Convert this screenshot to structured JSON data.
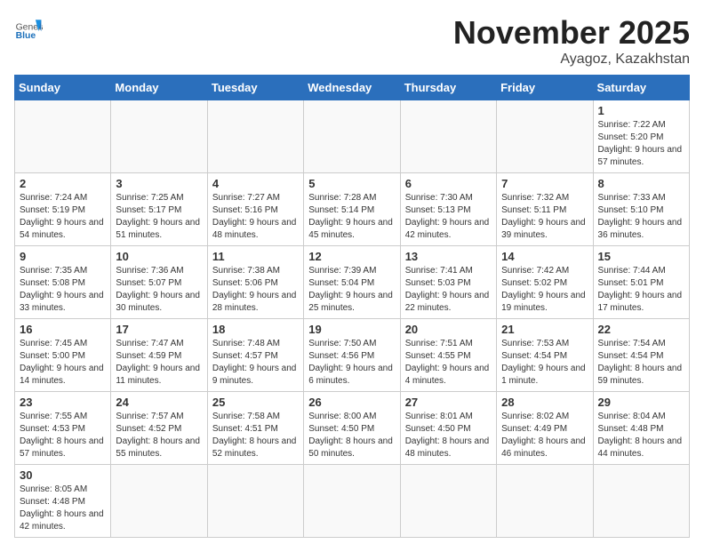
{
  "logo": {
    "general": "General",
    "blue": "Blue"
  },
  "title": "November 2025",
  "location": "Ayagoz, Kazakhstan",
  "weekdays": [
    "Sunday",
    "Monday",
    "Tuesday",
    "Wednesday",
    "Thursday",
    "Friday",
    "Saturday"
  ],
  "weeks": [
    [
      {
        "day": "",
        "info": ""
      },
      {
        "day": "",
        "info": ""
      },
      {
        "day": "",
        "info": ""
      },
      {
        "day": "",
        "info": ""
      },
      {
        "day": "",
        "info": ""
      },
      {
        "day": "",
        "info": ""
      },
      {
        "day": "1",
        "info": "Sunrise: 7:22 AM\nSunset: 5:20 PM\nDaylight: 9 hours\nand 57 minutes."
      }
    ],
    [
      {
        "day": "2",
        "info": "Sunrise: 7:24 AM\nSunset: 5:19 PM\nDaylight: 9 hours\nand 54 minutes."
      },
      {
        "day": "3",
        "info": "Sunrise: 7:25 AM\nSunset: 5:17 PM\nDaylight: 9 hours\nand 51 minutes."
      },
      {
        "day": "4",
        "info": "Sunrise: 7:27 AM\nSunset: 5:16 PM\nDaylight: 9 hours\nand 48 minutes."
      },
      {
        "day": "5",
        "info": "Sunrise: 7:28 AM\nSunset: 5:14 PM\nDaylight: 9 hours\nand 45 minutes."
      },
      {
        "day": "6",
        "info": "Sunrise: 7:30 AM\nSunset: 5:13 PM\nDaylight: 9 hours\nand 42 minutes."
      },
      {
        "day": "7",
        "info": "Sunrise: 7:32 AM\nSunset: 5:11 PM\nDaylight: 9 hours\nand 39 minutes."
      },
      {
        "day": "8",
        "info": "Sunrise: 7:33 AM\nSunset: 5:10 PM\nDaylight: 9 hours\nand 36 minutes."
      }
    ],
    [
      {
        "day": "9",
        "info": "Sunrise: 7:35 AM\nSunset: 5:08 PM\nDaylight: 9 hours\nand 33 minutes."
      },
      {
        "day": "10",
        "info": "Sunrise: 7:36 AM\nSunset: 5:07 PM\nDaylight: 9 hours\nand 30 minutes."
      },
      {
        "day": "11",
        "info": "Sunrise: 7:38 AM\nSunset: 5:06 PM\nDaylight: 9 hours\nand 28 minutes."
      },
      {
        "day": "12",
        "info": "Sunrise: 7:39 AM\nSunset: 5:04 PM\nDaylight: 9 hours\nand 25 minutes."
      },
      {
        "day": "13",
        "info": "Sunrise: 7:41 AM\nSunset: 5:03 PM\nDaylight: 9 hours\nand 22 minutes."
      },
      {
        "day": "14",
        "info": "Sunrise: 7:42 AM\nSunset: 5:02 PM\nDaylight: 9 hours\nand 19 minutes."
      },
      {
        "day": "15",
        "info": "Sunrise: 7:44 AM\nSunset: 5:01 PM\nDaylight: 9 hours\nand 17 minutes."
      }
    ],
    [
      {
        "day": "16",
        "info": "Sunrise: 7:45 AM\nSunset: 5:00 PM\nDaylight: 9 hours\nand 14 minutes."
      },
      {
        "day": "17",
        "info": "Sunrise: 7:47 AM\nSunset: 4:59 PM\nDaylight: 9 hours\nand 11 minutes."
      },
      {
        "day": "18",
        "info": "Sunrise: 7:48 AM\nSunset: 4:57 PM\nDaylight: 9 hours\nand 9 minutes."
      },
      {
        "day": "19",
        "info": "Sunrise: 7:50 AM\nSunset: 4:56 PM\nDaylight: 9 hours\nand 6 minutes."
      },
      {
        "day": "20",
        "info": "Sunrise: 7:51 AM\nSunset: 4:55 PM\nDaylight: 9 hours\nand 4 minutes."
      },
      {
        "day": "21",
        "info": "Sunrise: 7:53 AM\nSunset: 4:54 PM\nDaylight: 9 hours\nand 1 minute."
      },
      {
        "day": "22",
        "info": "Sunrise: 7:54 AM\nSunset: 4:54 PM\nDaylight: 8 hours\nand 59 minutes."
      }
    ],
    [
      {
        "day": "23",
        "info": "Sunrise: 7:55 AM\nSunset: 4:53 PM\nDaylight: 8 hours\nand 57 minutes."
      },
      {
        "day": "24",
        "info": "Sunrise: 7:57 AM\nSunset: 4:52 PM\nDaylight: 8 hours\nand 55 minutes."
      },
      {
        "day": "25",
        "info": "Sunrise: 7:58 AM\nSunset: 4:51 PM\nDaylight: 8 hours\nand 52 minutes."
      },
      {
        "day": "26",
        "info": "Sunrise: 8:00 AM\nSunset: 4:50 PM\nDaylight: 8 hours\nand 50 minutes."
      },
      {
        "day": "27",
        "info": "Sunrise: 8:01 AM\nSunset: 4:50 PM\nDaylight: 8 hours\nand 48 minutes."
      },
      {
        "day": "28",
        "info": "Sunrise: 8:02 AM\nSunset: 4:49 PM\nDaylight: 8 hours\nand 46 minutes."
      },
      {
        "day": "29",
        "info": "Sunrise: 8:04 AM\nSunset: 4:48 PM\nDaylight: 8 hours\nand 44 minutes."
      }
    ],
    [
      {
        "day": "30",
        "info": "Sunrise: 8:05 AM\nSunset: 4:48 PM\nDaylight: 8 hours\nand 42 minutes."
      },
      {
        "day": "",
        "info": ""
      },
      {
        "day": "",
        "info": ""
      },
      {
        "day": "",
        "info": ""
      },
      {
        "day": "",
        "info": ""
      },
      {
        "day": "",
        "info": ""
      },
      {
        "day": "",
        "info": ""
      }
    ]
  ]
}
